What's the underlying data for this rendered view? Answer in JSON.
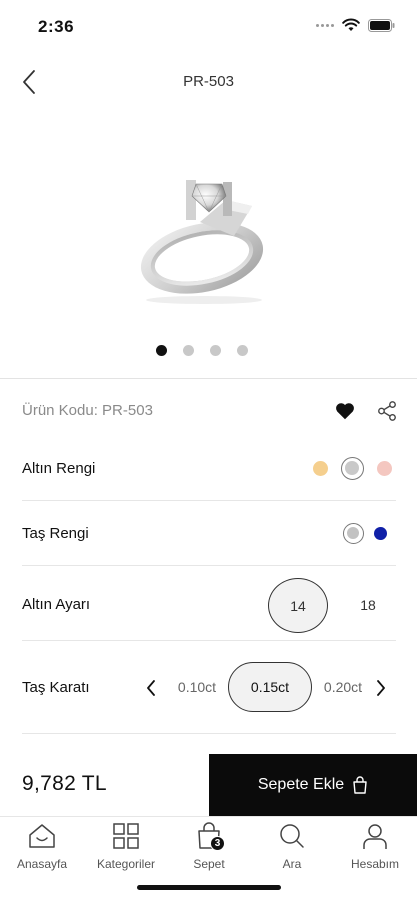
{
  "status_bar": {
    "time": "2:36"
  },
  "header": {
    "title": "PR-503"
  },
  "product": {
    "image": "silver-solitaire-ring",
    "carousel": {
      "count": 4,
      "active_index": 0
    },
    "code_label": "Ürün Kodu: PR-503",
    "favorited": true
  },
  "options": {
    "gold_color": {
      "label": "Altın Rengi",
      "swatches": [
        {
          "color": "#f5cf8e",
          "selected": false
        },
        {
          "color": "#c9c9c9",
          "selected": true
        },
        {
          "color": "#f4c7c0",
          "selected": false
        }
      ]
    },
    "stone_color": {
      "label": "Taş Rengi",
      "swatches": [
        {
          "color": "#c2c2c2",
          "selected": true
        },
        {
          "color": "#1020a8",
          "selected": false
        }
      ]
    },
    "gold_karat": {
      "label": "Altın Ayarı",
      "values": [
        "14",
        "18"
      ],
      "selected": "14"
    },
    "stone_carat": {
      "label": "Taş Karatı",
      "values": [
        "0.10ct",
        "0.15ct",
        "0.20ct"
      ],
      "selected": "0.15ct"
    }
  },
  "purchase": {
    "price": "9,782 TL",
    "add_to_cart_label": "Sepete Ekle"
  },
  "tab_bar": {
    "items": [
      {
        "label": "Anasayfa",
        "icon": "home-icon"
      },
      {
        "label": "Kategoriler",
        "icon": "grid-icon"
      },
      {
        "label": "Sepet",
        "icon": "bag-icon",
        "badge": "3"
      },
      {
        "label": "Ara",
        "icon": "search-icon"
      },
      {
        "label": "Hesabım",
        "icon": "user-icon"
      }
    ]
  }
}
